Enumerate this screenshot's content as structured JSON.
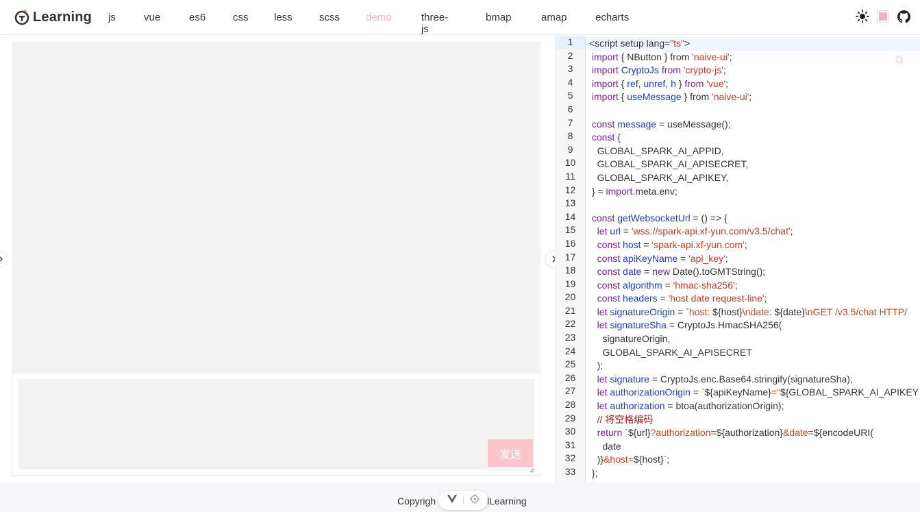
{
  "header": {
    "logo_text": "Learning",
    "nav": [
      {
        "label": "js",
        "active": false
      },
      {
        "label": "vue",
        "active": false
      },
      {
        "label": "es6",
        "active": false
      },
      {
        "label": "css",
        "active": false
      },
      {
        "label": "less",
        "active": false
      },
      {
        "label": "scss",
        "active": false
      },
      {
        "label": "demo",
        "active": true
      },
      {
        "label": "three-js",
        "active": false
      },
      {
        "label": "bmap",
        "active": false
      },
      {
        "label": "amap",
        "active": false
      },
      {
        "label": "echarts",
        "active": false
      }
    ],
    "tools": {
      "theme_icon": "sun-icon",
      "color_swatch": "#f7b5be",
      "github_icon": "github-icon"
    }
  },
  "chat": {
    "send_label": "发送",
    "input_value": ""
  },
  "editor": {
    "current_line": 1,
    "lines": [
      [
        [
          "",
          "<script setup lang="
        ],
        [
          "str",
          "\"ts\""
        ],
        [
          "",
          ">"
        ]
      ],
      [
        [
          "",
          " "
        ],
        [
          "kw",
          "import"
        ],
        [
          "",
          " { NButton } from "
        ],
        [
          "str",
          "'naive-ui'"
        ],
        [
          "",
          ";"
        ]
      ],
      [
        [
          "",
          " "
        ],
        [
          "kw",
          "import"
        ],
        [
          "",
          " "
        ],
        [
          "fn",
          "CryptoJs"
        ],
        [
          "",
          " "
        ],
        [
          "kw",
          "from"
        ],
        [
          "",
          " "
        ],
        [
          "str",
          "'crypto-js'"
        ],
        [
          "",
          ";"
        ]
      ],
      [
        [
          "",
          " "
        ],
        [
          "kw",
          "import"
        ],
        [
          "",
          " { "
        ],
        [
          "fn",
          "ref"
        ],
        [
          "",
          ", "
        ],
        [
          "fn",
          "unref"
        ],
        [
          "",
          ", "
        ],
        [
          "fn",
          "h"
        ],
        [
          "",
          " } "
        ],
        [
          "kw",
          "from"
        ],
        [
          "",
          " "
        ],
        [
          "str",
          "'vue'"
        ],
        [
          "",
          ";"
        ]
      ],
      [
        [
          "",
          " "
        ],
        [
          "kw",
          "import"
        ],
        [
          "",
          " { "
        ],
        [
          "fn",
          "useMessage"
        ],
        [
          "",
          " } from "
        ],
        [
          "str",
          "'naive-ui'"
        ],
        [
          "",
          ";"
        ]
      ],
      [
        [
          "",
          ""
        ]
      ],
      [
        [
          "",
          " "
        ],
        [
          "kw",
          "const"
        ],
        [
          "",
          " "
        ],
        [
          "fn",
          "message"
        ],
        [
          "",
          " = useMessage();"
        ]
      ],
      [
        [
          "",
          " "
        ],
        [
          "kw",
          "const"
        ],
        [
          "",
          " {"
        ]
      ],
      [
        [
          "",
          "   GLOBAL_SPARK_AI_APPID,"
        ]
      ],
      [
        [
          "",
          "   GLOBAL_SPARK_AI_APISECRET,"
        ]
      ],
      [
        [
          "",
          "   GLOBAL_SPARK_AI_APIKEY,"
        ]
      ],
      [
        [
          "",
          " } = "
        ],
        [
          "kw",
          "import"
        ],
        [
          "",
          ".meta.env;"
        ]
      ],
      [
        [
          "",
          ""
        ]
      ],
      [
        [
          "",
          " "
        ],
        [
          "kw",
          "const"
        ],
        [
          "",
          " "
        ],
        [
          "fn",
          "getWebsocketUrl"
        ],
        [
          "",
          " = () => {"
        ]
      ],
      [
        [
          "",
          "   "
        ],
        [
          "kw",
          "let"
        ],
        [
          "",
          " "
        ],
        [
          "fn",
          "url"
        ],
        [
          "",
          " = "
        ],
        [
          "str",
          "'wss://spark-api.xf-yun.com/v3.5/chat'"
        ],
        [
          "",
          ";"
        ]
      ],
      [
        [
          "",
          "   "
        ],
        [
          "kw",
          "const"
        ],
        [
          "",
          " "
        ],
        [
          "fn",
          "host"
        ],
        [
          "",
          " = "
        ],
        [
          "str",
          "'spark-api.xf-yun.com'"
        ],
        [
          "",
          ";"
        ]
      ],
      [
        [
          "",
          "   "
        ],
        [
          "kw",
          "const"
        ],
        [
          "",
          " "
        ],
        [
          "fn",
          "apiKeyName"
        ],
        [
          "",
          " = "
        ],
        [
          "str",
          "'api_key'"
        ],
        [
          "",
          ";"
        ]
      ],
      [
        [
          "",
          "   "
        ],
        [
          "kw",
          "const"
        ],
        [
          "",
          " "
        ],
        [
          "fn",
          "date"
        ],
        [
          "",
          " = "
        ],
        [
          "kw",
          "new"
        ],
        [
          "",
          " Date().toGMTString();"
        ]
      ],
      [
        [
          "",
          "   "
        ],
        [
          "kw",
          "const"
        ],
        [
          "",
          " "
        ],
        [
          "fn",
          "algorithm"
        ],
        [
          "",
          " = "
        ],
        [
          "str",
          "'hmac-sha256'"
        ],
        [
          "",
          ";"
        ]
      ],
      [
        [
          "",
          "   "
        ],
        [
          "kw",
          "const"
        ],
        [
          "",
          " "
        ],
        [
          "fn",
          "headers"
        ],
        [
          "",
          " = "
        ],
        [
          "str",
          "'host date request-line'"
        ],
        [
          "",
          ";"
        ]
      ],
      [
        [
          "",
          "   "
        ],
        [
          "kw",
          "let"
        ],
        [
          "",
          " "
        ],
        [
          "fn",
          "signatureOrigin"
        ],
        [
          "",
          " = "
        ],
        [
          "tmpl",
          "`host: "
        ],
        [
          "",
          "${host}"
        ],
        [
          "tmpl",
          "\\ndate: "
        ],
        [
          "",
          "${date}"
        ],
        [
          "tmpl",
          "\\nGET /v3.5/chat HTTP/"
        ]
      ],
      [
        [
          "",
          "   "
        ],
        [
          "kw",
          "let"
        ],
        [
          "",
          " "
        ],
        [
          "fn",
          "signatureSha"
        ],
        [
          "",
          " = CryptoJs.HmacSHA256("
        ]
      ],
      [
        [
          "",
          "     signatureOrigin,"
        ]
      ],
      [
        [
          "",
          "     GLOBAL_SPARK_AI_APISECRET"
        ]
      ],
      [
        [
          "",
          "   );"
        ]
      ],
      [
        [
          "",
          "   "
        ],
        [
          "kw",
          "let"
        ],
        [
          "",
          " "
        ],
        [
          "fn",
          "signature"
        ],
        [
          "",
          " = CryptoJs.enc.Base64.stringify(signatureSha);"
        ]
      ],
      [
        [
          "",
          "   "
        ],
        [
          "kw",
          "let"
        ],
        [
          "",
          " "
        ],
        [
          "fn",
          "authorizationOrigin"
        ],
        [
          "",
          " = "
        ],
        [
          "tmpl",
          "`"
        ],
        [
          "",
          "${apiKeyName}"
        ],
        [
          "tmpl",
          "=\""
        ],
        [
          "",
          "${GLOBAL_SPARK_AI_APIKEY"
        ]
      ],
      [
        [
          "",
          "   "
        ],
        [
          "kw",
          "let"
        ],
        [
          "",
          " "
        ],
        [
          "fn",
          "authorization"
        ],
        [
          "",
          " = btoa(authorizationOrigin);"
        ]
      ],
      [
        [
          "",
          "   "
        ],
        [
          "cm",
          "// 将空格编码"
        ]
      ],
      [
        [
          "",
          "   "
        ],
        [
          "kw",
          "return"
        ],
        [
          "",
          " "
        ],
        [
          "tmpl",
          "`"
        ],
        [
          "",
          "${url}"
        ],
        [
          "tmpl",
          "?authorization="
        ],
        [
          "",
          "${authorization}"
        ],
        [
          "tmpl",
          "&date="
        ],
        [
          "",
          "${encodeURI("
        ]
      ],
      [
        [
          "",
          "     date"
        ]
      ],
      [
        [
          "",
          "   )}"
        ],
        [
          "tmpl",
          "&host="
        ],
        [
          "",
          "${host}"
        ],
        [
          "tmpl",
          "`"
        ],
        [
          "",
          ";"
        ]
      ],
      [
        [
          "",
          " };"
        ]
      ]
    ]
  },
  "footer": {
    "text_left": "Copyrigh",
    "text_right": "lLearning"
  }
}
